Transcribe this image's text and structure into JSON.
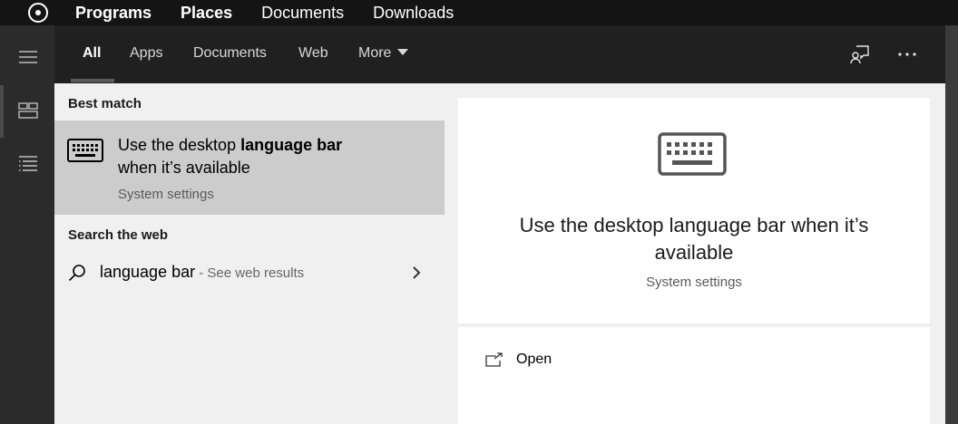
{
  "topbar": {
    "menu": [
      "Programs",
      "Places",
      "Documents",
      "Downloads"
    ]
  },
  "tabs": {
    "all": "All",
    "apps": "Apps",
    "documents": "Documents",
    "web": "Web",
    "more": "More"
  },
  "results": {
    "best_match_heading": "Best match",
    "best_title_prefix": "Use the desktop ",
    "best_title_bold": "language bar",
    "best_title_suffix": "when it’s available",
    "best_subtitle": "System settings",
    "web_heading": "Search the web",
    "web_query": "language bar",
    "web_suffix": " - See web results"
  },
  "detail": {
    "title": "Use the desktop language bar when it’s available",
    "subtitle": "System settings",
    "open_label": "Open"
  },
  "icons": {
    "activities": "activities-icon",
    "hamburger": "hamburger-icon",
    "layout": "layout-icon",
    "list": "list-icon",
    "feedback": "feedback-icon",
    "more": "ellipsis-icon",
    "keyboard": "keyboard-icon",
    "search": "search-icon",
    "chevron": "chevron-right-icon",
    "open": "open-external-icon"
  },
  "colors": {
    "selected_row": "#cccccc",
    "pane_bg": "#f0f0f0",
    "header_bg": "#202020"
  }
}
